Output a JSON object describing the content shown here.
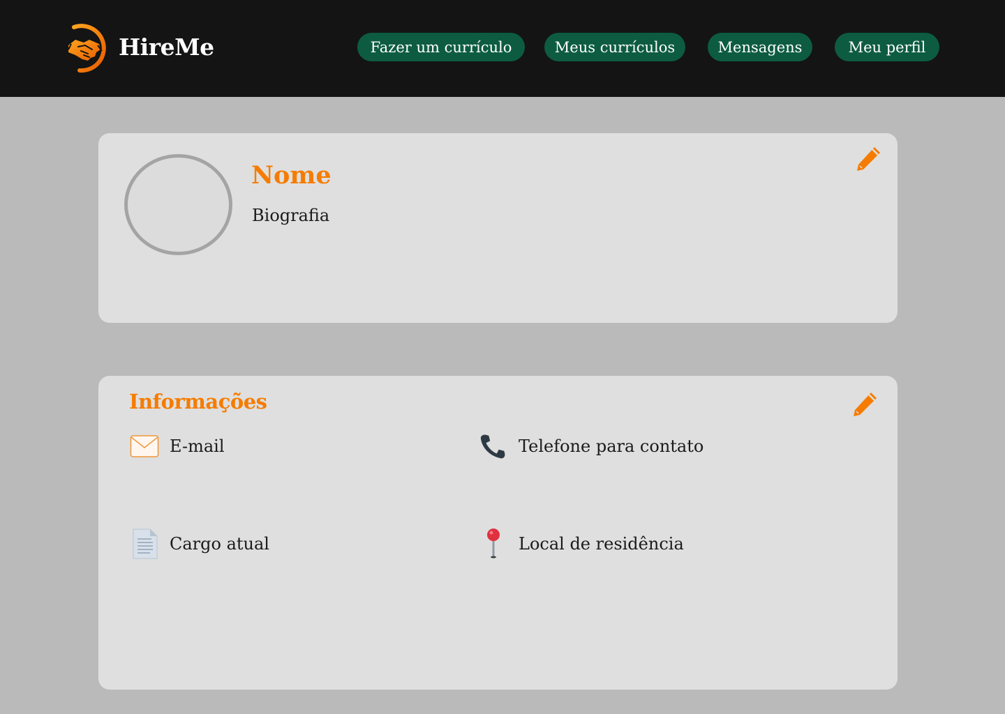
{
  "header": {
    "brand": "HireMe",
    "logo_icon": "handshake-logo-icon",
    "nav": [
      {
        "label": "Fazer um currículo"
      },
      {
        "label": "Meus currículos"
      },
      {
        "label": "Mensagens"
      },
      {
        "label": "Meu perfil"
      }
    ]
  },
  "profile": {
    "name": "Nome",
    "bio": "Biografia",
    "edit_icon": "pencil-icon"
  },
  "info": {
    "title": "Informações",
    "edit_icon": "pencil-icon",
    "items": [
      {
        "label": "E-mail",
        "icon": "envelope-icon"
      },
      {
        "label": "Telefone para contato",
        "icon": "phone-icon"
      },
      {
        "label": "Cargo atual",
        "icon": "document-icon"
      },
      {
        "label": "Local de residência",
        "icon": "pushpin-icon"
      }
    ]
  },
  "colors": {
    "accent": "#f57c00",
    "nav_button": "#0d5c41",
    "topbar": "#141414",
    "background": "#bababa",
    "card": "#dfdfdf"
  }
}
